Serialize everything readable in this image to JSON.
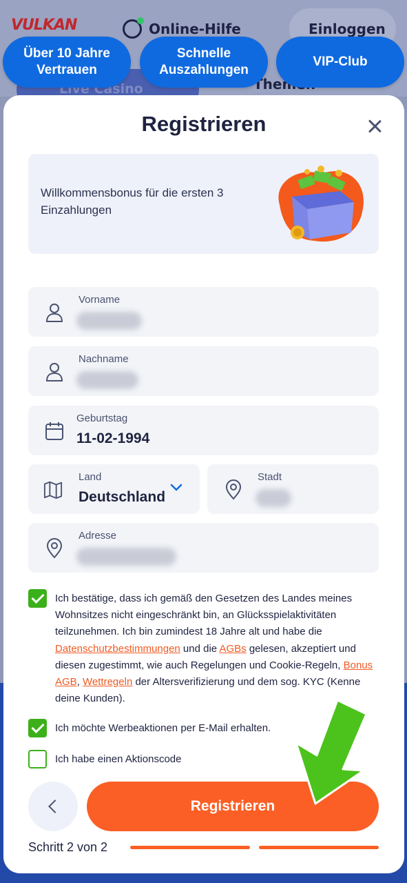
{
  "background": {
    "logo": "VULKAN",
    "help_label": "Online-Hilfe",
    "login_label": "Einloggen",
    "tab_left": "Live Casino",
    "tab_right": "Themen"
  },
  "pills": [
    {
      "label": "Über 10 Jahre Vertrauen"
    },
    {
      "label": "Schnelle Auszahlungen"
    },
    {
      "label": "VIP-Club"
    }
  ],
  "modal": {
    "title": "Registrieren",
    "bonus_text": "Willkommensbonus für die ersten 3 Einzahlungen",
    "fields": {
      "vorname": {
        "label": "Vorname",
        "value": ""
      },
      "nachname": {
        "label": "Nachname",
        "value": ""
      },
      "geburtstag": {
        "label": "Geburtstag",
        "value": "11-02-1994"
      },
      "land": {
        "label": "Land",
        "value": "Deutschland"
      },
      "stadt": {
        "label": "Stadt",
        "value": ""
      },
      "adresse": {
        "label": "Adresse",
        "value": ""
      }
    },
    "consent": {
      "p1": "Ich bestätige, dass ich gemäß den Gesetzen des Landes meines Wohnsitzes nicht eingeschränkt bin, an Glücksspielaktivitäten teilzunehmen. Ich bin zumindest 18 Jahre alt und habe die ",
      "link_privacy": "Datenschutzbestimmungen",
      "p2": " und die ",
      "link_agb": "AGBs",
      "p3": " gelesen, akzeptiert und diesen zugestimmt, wie auch Regelungen und Cookie-Regeln, ",
      "link_bonus": "Bonus AGB",
      "p4": ", ",
      "link_wett": "Wettregeln",
      "p5": " der Altersverifizierung und dem sog. KYC (Kenne deine Kunden).",
      "checked": true
    },
    "promo_email": {
      "label": "Ich möchte Werbeaktionen per E-Mail erhalten.",
      "checked": true
    },
    "promo_code": {
      "label": "Ich habe einen Aktionscode",
      "checked": false
    },
    "submit_label": "Registrieren",
    "step_label": "Schritt 2 von 2",
    "step_current": 2,
    "step_total": 2
  },
  "colors": {
    "accent": "#fb5f25",
    "primary_blue": "#0f6ae0",
    "check_green": "#3cb01a",
    "text_dark": "#1f2340"
  }
}
